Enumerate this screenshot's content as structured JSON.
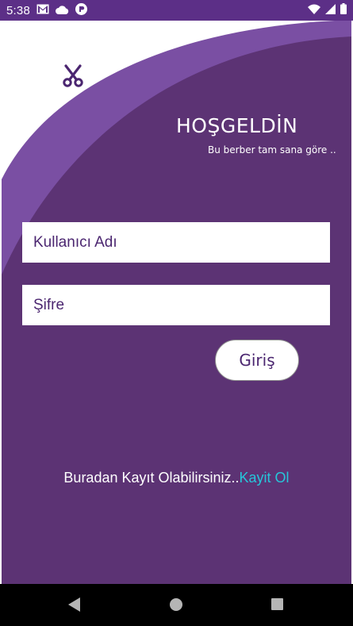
{
  "status_bar": {
    "time": "5:38",
    "left_icons": [
      "gmail-icon",
      "cloud-icon",
      "app-icon"
    ],
    "right_icons": [
      "wifi-icon",
      "signal-icon",
      "battery-icon"
    ]
  },
  "header": {
    "logo_icon": "scissors-icon",
    "title": "HOŞGELDİN",
    "subtitle": "Bu berber tam sana göre .."
  },
  "form": {
    "username_placeholder": "Kullanıcı Adı",
    "password_placeholder": "Şifre",
    "login_label": "Giriş"
  },
  "footer": {
    "register_text": "Buradan Kayıt Olabilirsiniz..",
    "register_link": "Kayit Ol"
  },
  "nav_bar": {
    "icons": [
      "back-icon",
      "home-icon",
      "recents-icon"
    ]
  },
  "colors": {
    "primary": "#5c3374",
    "status_bar": "#5c2f87",
    "accent_link": "#26c6da",
    "text_purple": "#4b2670"
  }
}
